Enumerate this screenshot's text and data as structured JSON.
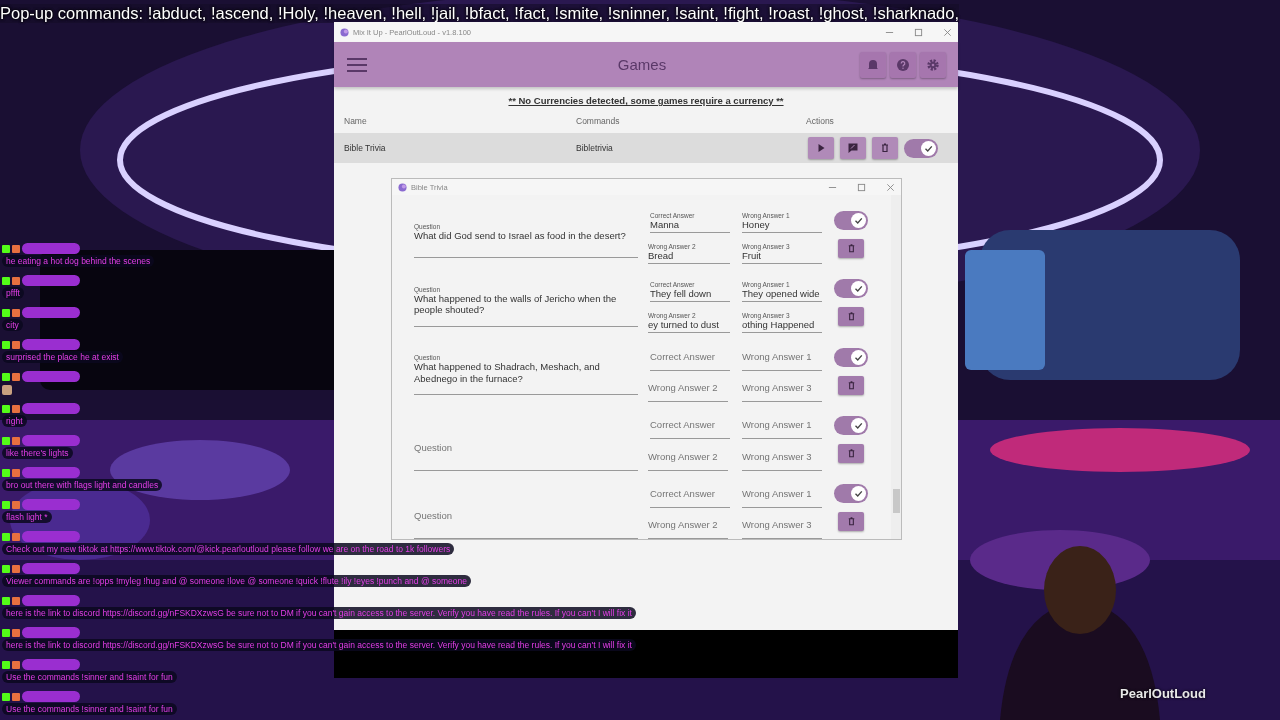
{
  "stream_banner": "Pop-up commands: !abduct, !ascend, !Holy, !heaven, !hell,  !jail, !bfact, !fact, !smite, !sninner, !saint, !fight, !roast, !ghost, !sharknado,",
  "window": {
    "title": "Mix It Up - PearlOutLoud - v1.8.100",
    "header": {
      "title": "Games"
    },
    "notice": "** No Currencies detected, some games require a currency **",
    "table": {
      "columns": [
        "Name",
        "Commands",
        "Actions"
      ],
      "rows": [
        {
          "name": "Bible Trivia",
          "command": "Bibletrivia",
          "enabled": true
        }
      ]
    }
  },
  "dialog": {
    "title": "Bible Trivia",
    "questions": [
      {
        "question": {
          "label": "Question",
          "value": "What did God send to Israel as food in the desert?"
        },
        "answers": [
          {
            "label": "Correct Answer",
            "value": "Manna"
          },
          {
            "label": "Wrong Answer 1",
            "value": "Honey"
          },
          {
            "label": "Wrong Answer 2",
            "value": "Bread"
          },
          {
            "label": "Wrong Answer 3",
            "value": "Fruit"
          }
        ],
        "enabled": true
      },
      {
        "question": {
          "label": "Question",
          "value": "What happened to the walls of Jericho when the people shouted?"
        },
        "answers": [
          {
            "label": "Correct Answer",
            "value": "They fell down"
          },
          {
            "label": "Wrong Answer 1",
            "value": "They opened wide"
          },
          {
            "label": "Wrong Answer 2",
            "value": "ey turned to dust"
          },
          {
            "label": "Wrong Answer 3",
            "value": "othing Happened"
          }
        ],
        "enabled": true
      },
      {
        "question": {
          "label": "Question",
          "value": "What happened to Shadrach, Meshach, and Abednego in the furnace?"
        },
        "answers": [
          {
            "placeholder": "Correct Answer"
          },
          {
            "placeholder": "Wrong Answer 1"
          },
          {
            "placeholder": "Wrong Answer 2"
          },
          {
            "placeholder": "Wrong Answer 3"
          }
        ],
        "enabled": true
      },
      {
        "question": {
          "placeholder": "Question"
        },
        "answers": [
          {
            "placeholder": "Correct Answer"
          },
          {
            "placeholder": "Wrong Answer 1"
          },
          {
            "placeholder": "Wrong Answer 2"
          },
          {
            "placeholder": "Wrong Answer 3"
          }
        ],
        "enabled": true
      },
      {
        "question": {
          "placeholder": "Question"
        },
        "answers": [
          {
            "placeholder": "Correct Answer"
          },
          {
            "placeholder": "Wrong Answer 1"
          },
          {
            "placeholder": "Wrong Answer 2"
          },
          {
            "placeholder": "Wrong Answer 3"
          }
        ],
        "enabled": true
      }
    ]
  },
  "chat": [
    {
      "kind": "text",
      "message": "he eating a hot dog behind the scenes"
    },
    {
      "kind": "text",
      "message": "pffft"
    },
    {
      "kind": "text",
      "message": "city"
    },
    {
      "kind": "text",
      "message": "surprised the place he at exist"
    },
    {
      "kind": "emote"
    },
    {
      "kind": "text",
      "message": "right"
    },
    {
      "kind": "text",
      "message": "like there's lights"
    },
    {
      "kind": "text",
      "message": "bro out there with flags light and candles"
    },
    {
      "kind": "text",
      "message": "flash light *"
    },
    {
      "kind": "text",
      "message": "Check out my new tiktok at https://www.tiktok.com/@kick.pearloutloud please follow we are on the road to 1k followers"
    },
    {
      "kind": "text",
      "message": "Viewer commands are !opps !myleg !hug and @ someone !love @ someone !quick !flute !ily !eyes !punch and @ someone"
    },
    {
      "kind": "text",
      "message": "here is the link to discord https://discord.gg/nFSKDXzwsG be sure not to DM if you can't gain access to the server. Verify you have read the rules. If you can't I will fix it"
    },
    {
      "kind": "text",
      "message": "here is the link to discord https://discord.gg/nFSKDXzwsG be sure not to DM if you can't gain access to the server. Verify you have read the rules. If you can't I will fix it"
    },
    {
      "kind": "text",
      "message": "Use the commands !sinner and !saint for fun"
    },
    {
      "kind": "text",
      "message": "Use the commands !sinner and !saint for fun"
    }
  ],
  "streamer_tag": "PearlOutLoud"
}
